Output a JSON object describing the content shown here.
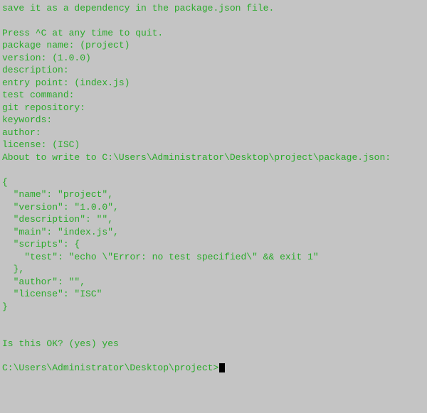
{
  "lines": {
    "l0": "save it as a dependency in the package.json file.",
    "l1": "",
    "l2": "Press ^C at any time to quit.",
    "l3": "package name: (project)",
    "l4": "version: (1.0.0)",
    "l5": "description:",
    "l6": "entry point: (index.js)",
    "l7": "test command:",
    "l8": "git repository:",
    "l9": "keywords:",
    "l10": "author:",
    "l11": "license: (ISC)",
    "l12": "About to write to C:\\Users\\Administrator\\Desktop\\project\\package.json:",
    "l13": "",
    "l14": "{",
    "l15": "  \"name\": \"project\",",
    "l16": "  \"version\": \"1.0.0\",",
    "l17": "  \"description\": \"\",",
    "l18": "  \"main\": \"index.js\",",
    "l19": "  \"scripts\": {",
    "l20": "    \"test\": \"echo \\\"Error: no test specified\\\" && exit 1\"",
    "l21": "  },",
    "l22": "  \"author\": \"\",",
    "l23": "  \"license\": \"ISC\"",
    "l24": "}",
    "l25": "",
    "l26": "",
    "l27": "Is this OK? (yes) yes",
    "l28": "",
    "prompt": "C:\\Users\\Administrator\\Desktop\\project>"
  }
}
